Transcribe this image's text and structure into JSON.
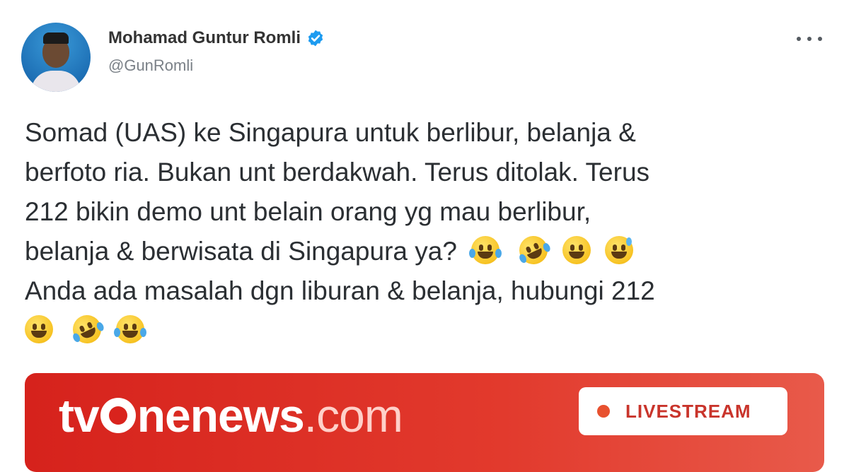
{
  "author": {
    "name": "Mohamad Guntur Romli",
    "handle": "@GunRomli",
    "verified": true
  },
  "menu": {
    "icon": "more-icon"
  },
  "tweet": {
    "line1": "Somad (UAS) ke Singapura untuk berlibur, belanja &",
    "line2": "berfoto ria. Bukan unt berdakwah. Terus ditolak. Terus",
    "line3": "212 bikin demo unt belain orang yg mau berlibur,",
    "line4": "belanja & berwisata di Singapura ya?",
    "line5": "Anda ada masalah dgn liburan & belanja, hubungi 212",
    "emoji_line4": [
      "joy-emoji",
      "rofl-emoji",
      "smiley-emoji",
      "sweat-smile-emoji"
    ],
    "emoji_line6": [
      "smiley-emoji",
      "rofl-emoji",
      "joy-emoji"
    ]
  },
  "banner": {
    "logo_tv": "tv",
    "logo_ne": "ne",
    "logo_news": "news",
    "logo_com": ".com",
    "live_label": "LIVESTREAM",
    "brand_color": "#d6221c"
  }
}
